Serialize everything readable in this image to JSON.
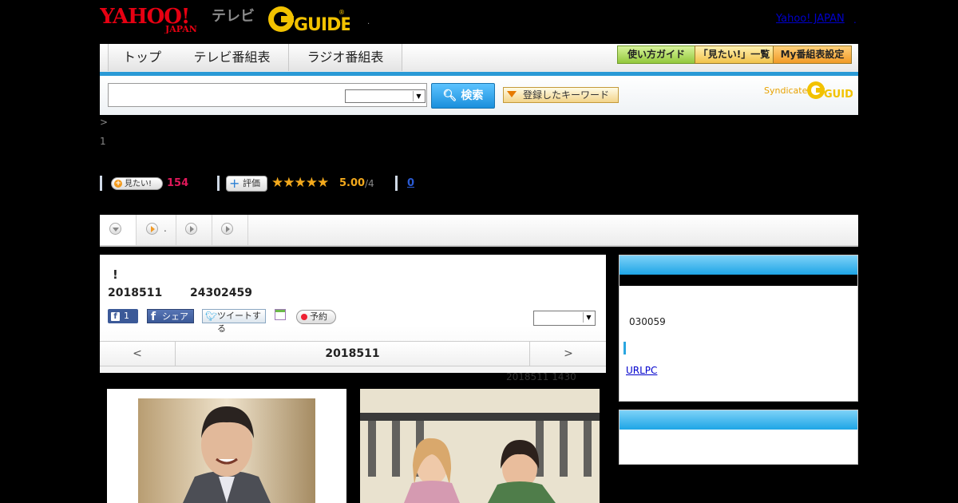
{
  "header": {
    "logo_yahoo": "YAHOO!",
    "logo_japan": "JAPAN",
    "logo_tv": "テレビ",
    "logo_gguide": "GUIDE",
    "dot": ".",
    "yahoo_link": "Yahoo! JAPAN",
    "yahoo_link_dot": "."
  },
  "nav": {
    "tabs": [
      {
        "label": "トップ"
      },
      {
        "label": "テレビ番組表"
      },
      {
        "label": "ラジオ番組表"
      }
    ],
    "buttons": {
      "guide": "使い方ガイド",
      "mitai": "「見たい!」一覧",
      "my": "My番組表設定"
    }
  },
  "search": {
    "input_value": "",
    "button_label": "検索",
    "keyword_button": "登録したキーワード",
    "syndicated": "Syndicated",
    "syndicated_logo": "GUIDE"
  },
  "breadcrumb": ">",
  "page_number": "1",
  "stats": {
    "mitai_label": "見たい!",
    "mitai_count": "154",
    "hyoka_label": "評価",
    "stars": "★★★★★",
    "rating": "5.00",
    "rating_count": "/4",
    "review_count": "0"
  },
  "subtabs": {
    "second_label": "."
  },
  "program": {
    "title": "!",
    "date": "2018511",
    "time": "24302459",
    "fb_like_count": "1",
    "fb_share": "シェア",
    "tweet": "ツイートする",
    "yoyaku": "予約",
    "day_prev": "<",
    "day_current": "2018511",
    "day_next": ">",
    "air_info": "2018511  1430"
  },
  "sidebar": {
    "code": "030059",
    "link": "URLPC"
  },
  "colors": {
    "accent_blue": "#2a9ad6",
    "rating_orange": "#f3a91c",
    "mitai_pink": "#e0185a",
    "facebook": "#3b5998"
  }
}
